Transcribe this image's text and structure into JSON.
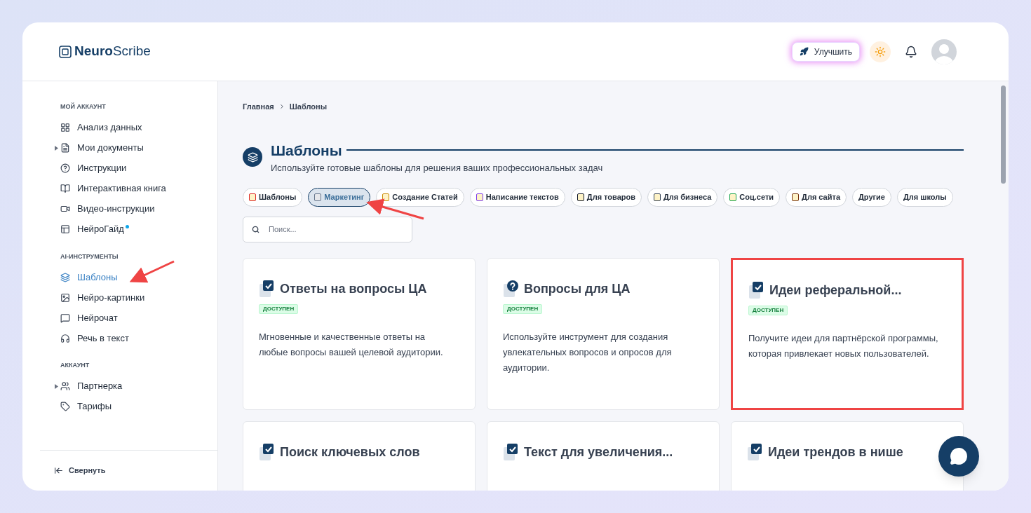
{
  "logo": {
    "bold": "Neuro",
    "regular": "Scribe"
  },
  "header": {
    "upgrade_button": "Улучшить"
  },
  "sidebar": {
    "sections": [
      {
        "title": "МОЙ АККАУНТ",
        "items": [
          {
            "label": "Анализ данных",
            "selected": false,
            "expandable": false,
            "new": false
          },
          {
            "label": "Мои документы",
            "selected": false,
            "expandable": true,
            "new": false
          },
          {
            "label": "Инструкции",
            "selected": false,
            "expandable": false,
            "new": false
          },
          {
            "label": "Интерактивная книга",
            "selected": false,
            "expandable": false,
            "new": false
          },
          {
            "label": "Видео-инструкции",
            "selected": false,
            "expandable": false,
            "new": false
          },
          {
            "label": "НейроГайд",
            "selected": false,
            "expandable": false,
            "new": true
          }
        ]
      },
      {
        "title": "AI-ИНСТРУМЕНТЫ",
        "items": [
          {
            "label": "Шаблоны",
            "selected": true,
            "expandable": false,
            "new": false
          },
          {
            "label": "Нейро-картинки",
            "selected": false,
            "expandable": false,
            "new": false
          },
          {
            "label": "Нейрочат",
            "selected": false,
            "expandable": false,
            "new": false
          },
          {
            "label": "Речь в текст",
            "selected": false,
            "expandable": false,
            "new": false
          }
        ]
      },
      {
        "title": "АККАУНТ",
        "items": [
          {
            "label": "Партнерка",
            "selected": false,
            "expandable": true,
            "new": false
          },
          {
            "label": "Тарифы",
            "selected": false,
            "expandable": false,
            "new": false
          }
        ]
      }
    ],
    "collapse": "Свернуть"
  },
  "breadcrumbs": [
    "Главная",
    "Шаблоны"
  ],
  "page": {
    "title": "Шаблоны",
    "subtitle": "Используйте готовые шаблоны для решения ваших профессиональных задач"
  },
  "categories": [
    {
      "label": "Шаблоны",
      "selected": false
    },
    {
      "label": "Маркетинг",
      "selected": true
    },
    {
      "label": "Создание Статей",
      "selected": false
    },
    {
      "label": "Написание текстов",
      "selected": false
    },
    {
      "label": "Для товаров",
      "selected": false
    },
    {
      "label": "Для бизнеса",
      "selected": false
    },
    {
      "label": "Соц.сети",
      "selected": false
    },
    {
      "label": "Для сайта",
      "selected": false
    },
    {
      "label": "Другие",
      "selected": false
    },
    {
      "label": "Для школы",
      "selected": false
    }
  ],
  "search": {
    "placeholder": "Поиск..."
  },
  "cards": [
    {
      "title": "Ответы на вопросы ЦА",
      "badge": "ДОСТУПЕН",
      "description": "Мгновенные и качественные ответы на любые вопросы вашей целевой аудитории.",
      "highlighted": false
    },
    {
      "title": "Вопросы для ЦА",
      "badge": "ДОСТУПЕН",
      "description": "Используйте инструмент для создания увлекательных вопросов и опросов для аудитории.",
      "highlighted": false
    },
    {
      "title": "Идеи реферальной...",
      "badge": "ДОСТУПЕН",
      "description": "Получите идеи для партнёрской программы, которая привлекает новых пользователей.",
      "highlighted": true
    },
    {
      "title": "Поиск ключевых слов",
      "highlighted": false
    },
    {
      "title": "Текст для увеличения...",
      "highlighted": false
    },
    {
      "title": "Идеи трендов в нише",
      "highlighted": false
    }
  ]
}
